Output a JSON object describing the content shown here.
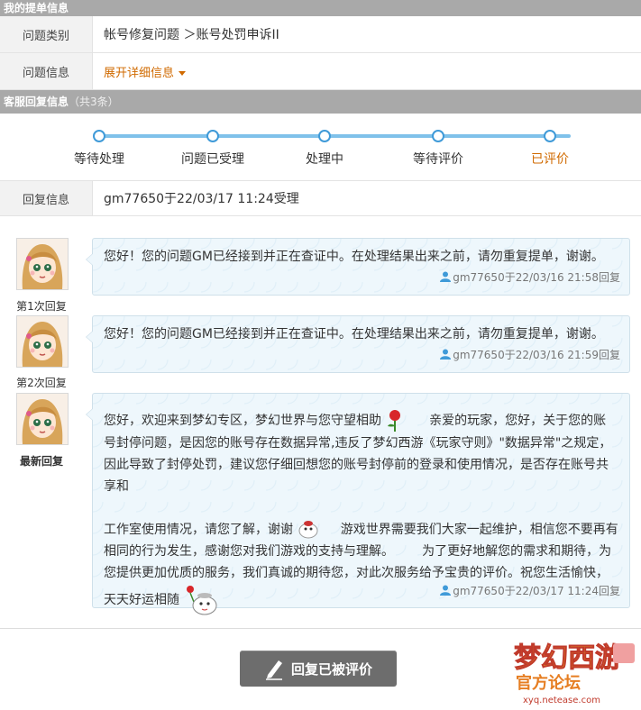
{
  "sections": {
    "ticket_header": "我的提单信息",
    "reply_header": "客服回复信息",
    "reply_count": "（共3条）"
  },
  "ticket": {
    "category_label": "问题类别",
    "category_value": "帐号修复问题 ＞账号处罚申诉II",
    "info_label": "问题信息",
    "info_toggle": "展开详细信息"
  },
  "progress": {
    "steps": [
      "等待处理",
      "问题已受理",
      "处理中",
      "等待评价",
      "已评价"
    ],
    "active_index": 4
  },
  "reply_info": {
    "label": "回复信息",
    "value": "gm77650于22/03/17 11:24受理"
  },
  "replies": [
    {
      "caption": "第1次回复",
      "text": "您好！您的问题GM已经接到并正在查证中。在处理结果出来之前，请勿重复提单，谢谢。",
      "meta": "gm77650于22/03/16 21:58回复"
    },
    {
      "caption": "第2次回复",
      "text": "您好！您的问题GM已经接到并正在查证中。在处理结果出来之前，请勿重复提单，谢谢。",
      "meta": "gm77650于22/03/16 21:59回复"
    },
    {
      "caption": "最新回复",
      "text_part1": "您好，欢迎来到梦幻专区，梦幻世界与您守望相助",
      "text_part2": "亲爱的玩家，您好，关于您的账号封停问题，是因您的账号存在数据异常,违反了梦幻西游《玩家守则》\"数据异常\"之规定，因此导致了封停处罚，建议您仔细回想您的账号封停前的登录和使用情况，是否存在账号共享和",
      "text_part3": "工作室使用情况，请您了解，谢谢",
      "text_part4": "游戏世界需要我们大家一起维护，相信您不要再有相同的行为发生，感谢您对我们游戏的支持与理解。",
      "text_part5": "为了更好地解您的需求和期待，为您提供更加优质的服务，我们真诚的期待您，对此次服务给予宝贵的评价。祝您生活愉快，",
      "text_part6": "天天好运相随",
      "meta": "gm77650于22/03/17 11:24回复"
    }
  ],
  "button": {
    "label": "回复已被评价"
  },
  "colors": {
    "accent": "#d06a00",
    "progress": "#3f9ad8",
    "header": "#a9a9a9",
    "button": "#6d6d6d"
  }
}
